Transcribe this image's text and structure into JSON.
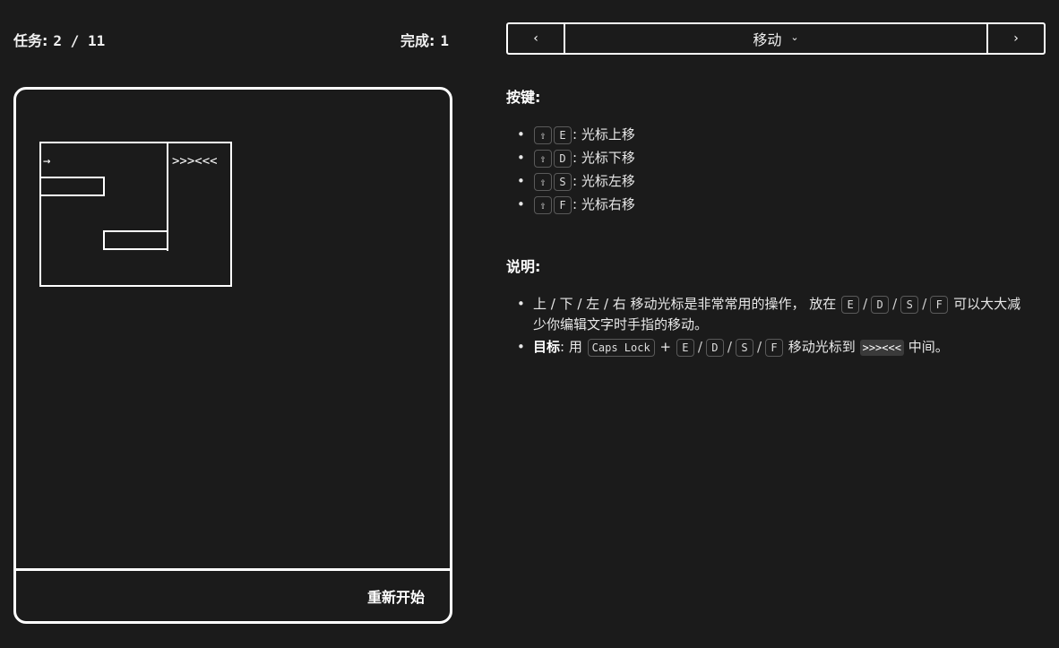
{
  "header": {
    "task_label": "任务:",
    "task_value": "2 / 11",
    "done_label": "完成:",
    "done_value": "1"
  },
  "nav": {
    "prev_label": "‹",
    "next_label": "›",
    "level_name": "移动",
    "dropdown_icon": "chevron-down-icon"
  },
  "game": {
    "cursor_glyph": "→",
    "goal_text": ">>><<<",
    "restart_label": "重新开始"
  },
  "keys": {
    "title": "按键:",
    "shift_glyph": "⇧",
    "items": [
      {
        "key": "E",
        "desc": "光标上移"
      },
      {
        "key": "D",
        "desc": "光标下移"
      },
      {
        "key": "S",
        "desc": "光标左移"
      },
      {
        "key": "F",
        "desc": "光标右移"
      }
    ],
    "colon": ":"
  },
  "notes": {
    "title": "说明:",
    "item1": {
      "prefix": "上 / 下 / 左 / 右 移动光标是非常常用的操作， 放在",
      "keys": [
        "E",
        "D",
        "S",
        "F"
      ],
      "suffix": "可以大大减少你编辑文字时手指的移动。"
    },
    "item2": {
      "label": "目标",
      "colon": ":",
      "use": "用",
      "modifier": "Caps Lock",
      "plus": "+",
      "keys": [
        "E",
        "D",
        "S",
        "F"
      ],
      "middle": "移动光标到",
      "target": ">>><<<",
      "suffix": "中间。"
    }
  }
}
